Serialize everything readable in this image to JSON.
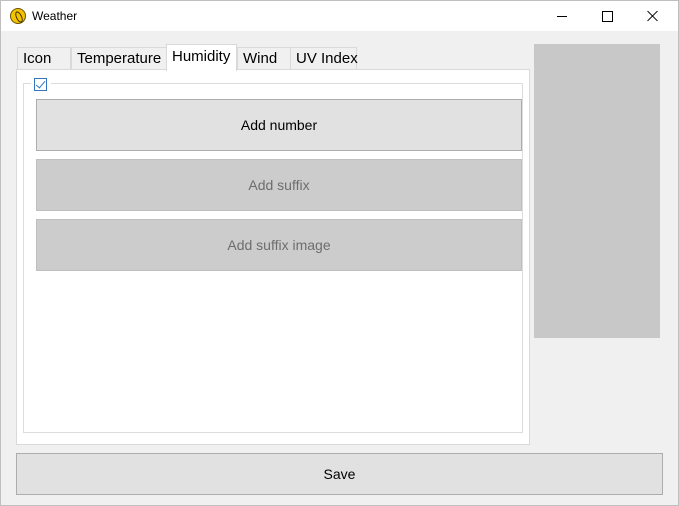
{
  "window": {
    "title": "Weather"
  },
  "tabs": [
    {
      "label": "Icon",
      "active": false
    },
    {
      "label": "Temperature",
      "active": false
    },
    {
      "label": "Humidity",
      "active": true
    },
    {
      "label": "Wind",
      "active": false
    },
    {
      "label": "UV Index",
      "active": false
    }
  ],
  "humidity_panel": {
    "enabled_checked": true,
    "buttons": [
      {
        "label": "Add number",
        "enabled": true
      },
      {
        "label": "Add suffix",
        "enabled": false
      },
      {
        "label": "Add suffix image",
        "enabled": false
      }
    ]
  },
  "footer": {
    "save_label": "Save"
  },
  "colors": {
    "accent": "#3374c1",
    "preview_bg": "#c8c8c8",
    "app_icon": "#f4c300"
  }
}
